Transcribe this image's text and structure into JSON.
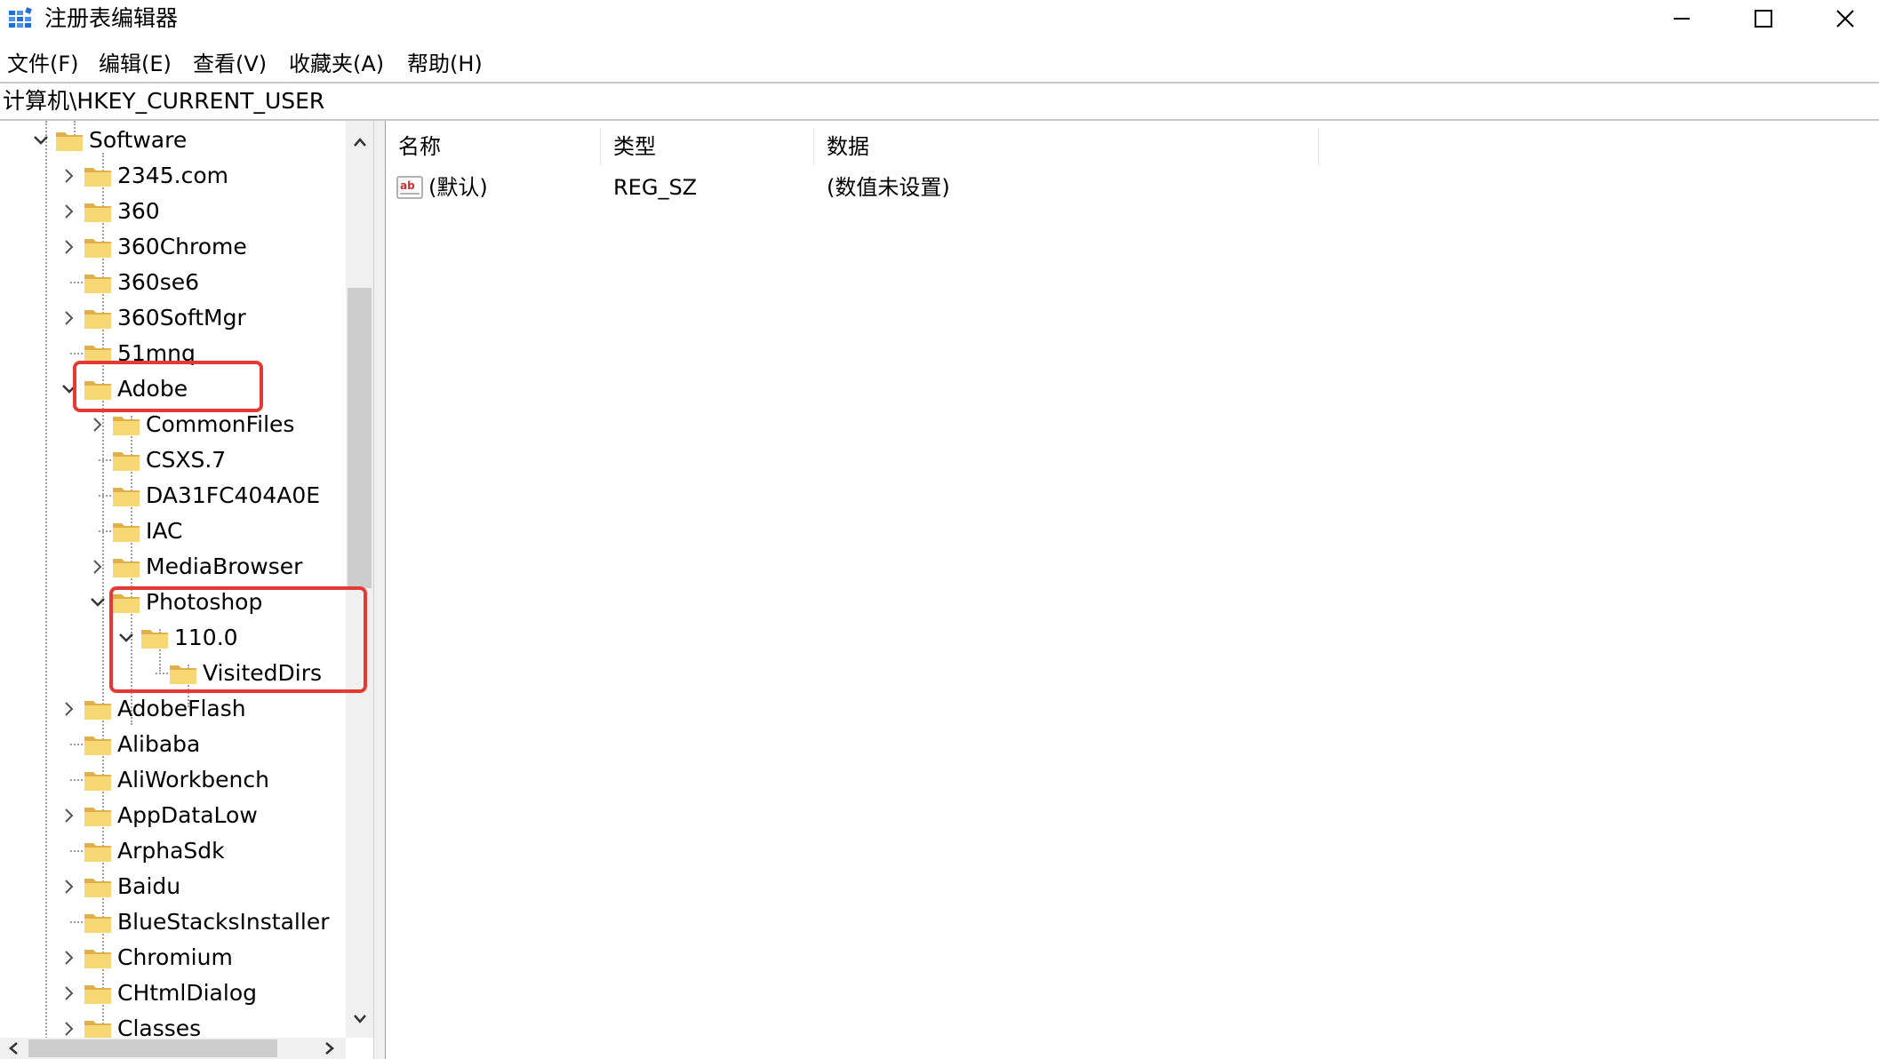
{
  "window": {
    "title": "注册表编辑器",
    "app_icon": "registry-editor-icon",
    "buttons": [
      "minimize-icon",
      "maximize-icon",
      "close-icon"
    ]
  },
  "menu": {
    "file": "文件(F)",
    "edit": "编辑(E)",
    "view": "查看(V)",
    "favorites": "收藏夹(A)",
    "help": "帮助(H)"
  },
  "address": "计算机\\HKEY_CURRENT_USER",
  "tree": [
    {
      "label": "Software",
      "level": 0,
      "state": "expanded"
    },
    {
      "label": "2345.com",
      "level": 1,
      "state": "collapsed"
    },
    {
      "label": "360",
      "level": 1,
      "state": "collapsed"
    },
    {
      "label": "360Chrome",
      "level": 1,
      "state": "collapsed"
    },
    {
      "label": "360se6",
      "level": 1,
      "state": "leaf"
    },
    {
      "label": "360SoftMgr",
      "level": 1,
      "state": "collapsed"
    },
    {
      "label": "51mnq",
      "level": 1,
      "state": "leaf"
    },
    {
      "label": "Adobe",
      "level": 1,
      "state": "expanded"
    },
    {
      "label": "CommonFiles",
      "level": 2,
      "state": "collapsed"
    },
    {
      "label": "CSXS.7",
      "level": 2,
      "state": "leaf"
    },
    {
      "label": "DA31FC404A0E",
      "level": 2,
      "state": "leaf"
    },
    {
      "label": "IAC",
      "level": 2,
      "state": "leaf"
    },
    {
      "label": "MediaBrowser",
      "level": 2,
      "state": "collapsed"
    },
    {
      "label": "Photoshop",
      "level": 2,
      "state": "expanded"
    },
    {
      "label": "110.0",
      "level": 3,
      "state": "expanded"
    },
    {
      "label": "VisitedDirs",
      "level": 4,
      "state": "leaf"
    },
    {
      "label": "AdobeFlash",
      "level": 1,
      "state": "collapsed"
    },
    {
      "label": "Alibaba",
      "level": 1,
      "state": "leaf"
    },
    {
      "label": "AliWorkbench",
      "level": 1,
      "state": "leaf"
    },
    {
      "label": "AppDataLow",
      "level": 1,
      "state": "collapsed"
    },
    {
      "label": "ArphaSdk",
      "level": 1,
      "state": "leaf"
    },
    {
      "label": "Baidu",
      "level": 1,
      "state": "collapsed"
    },
    {
      "label": "BlueStacksInstaller",
      "level": 1,
      "state": "leaf"
    },
    {
      "label": "Chromium",
      "level": 1,
      "state": "collapsed"
    },
    {
      "label": "CHtmlDialog",
      "level": 1,
      "state": "collapsed"
    },
    {
      "label": "Classes",
      "level": 1,
      "state": "collapsed"
    }
  ],
  "list": {
    "columns": [
      "名称",
      "类型",
      "数据"
    ],
    "rows": [
      {
        "name": "(默认)",
        "type": "REG_SZ",
        "data": "(数值未设置)",
        "icon": "string-value-icon"
      }
    ]
  },
  "colors": {
    "highlight": "#e53935",
    "folder": "#f8d775",
    "folder_dark": "#e0b14a",
    "app_icon_blue": "#1e6fd9"
  }
}
